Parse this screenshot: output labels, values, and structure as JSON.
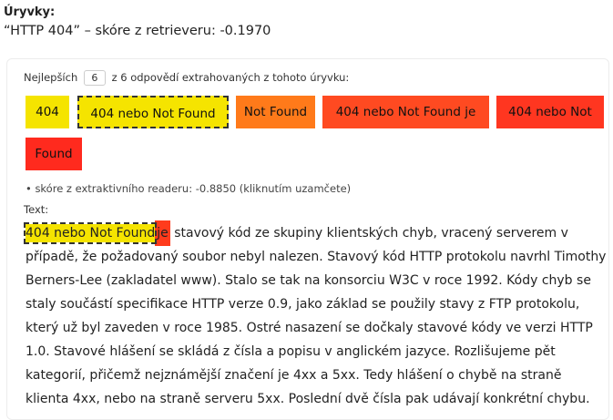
{
  "header": {
    "title": "Úryvky:",
    "subtitle": "“HTTP 404” – skóre z retrieveru: -0.1970"
  },
  "topn": {
    "prefix": "Nejlepších",
    "value": "6",
    "suffix": "z 6 odpovědí extrahovaných z tohoto úryvku:"
  },
  "answers": [
    {
      "label": "404",
      "color": "#f5e400"
    },
    {
      "label": "404 nebo Not Found",
      "color": "#f5e400"
    },
    {
      "label": "Not Found",
      "color": "#ff7a1a"
    },
    {
      "label": "404 nebo Not Found je",
      "color": "#ff4a21"
    },
    {
      "label": "404 nebo Not",
      "color": "#ff3620"
    },
    {
      "label": "Found",
      "color": "#ff2a1e"
    }
  ],
  "reader": "• skóre z extraktivního readeru: -0.8850 (kliknutím uzamčete)",
  "text_label": "Text:",
  "passage": {
    "highlight": "404 nebo Not Found",
    "highlight2": "je",
    "rest": " stavový kód ze skupiny klientských chyb, vracený serverem v případě, že požadovaný soubor nebyl nalezen. Stavový kód HTTP protokolu navrhl Timothy Berners-Lee (zakladatel www). Stalo se tak na konsorciu W3C v roce 1992. Kódy chyb se staly součástí specifikace HTTP verze 0.9, jako základ se použily stavy z FTP protokolu, který už byl zaveden v roce 1985. Ostré nasazení se dočkaly stavové kódy ve verzi HTTP 1.0. Stavové hlášení se skládá z čísla a popisu v anglickém jazyce. Rozlišujeme pět kategorií, přičemž nejznámější značení je 4xx a 5xx. Tedy hlášení o chybě na straně klienta 4xx, nebo na straně serveru 5xx. Poslední dvě čísla pak udávají konkrétní chybu."
  }
}
